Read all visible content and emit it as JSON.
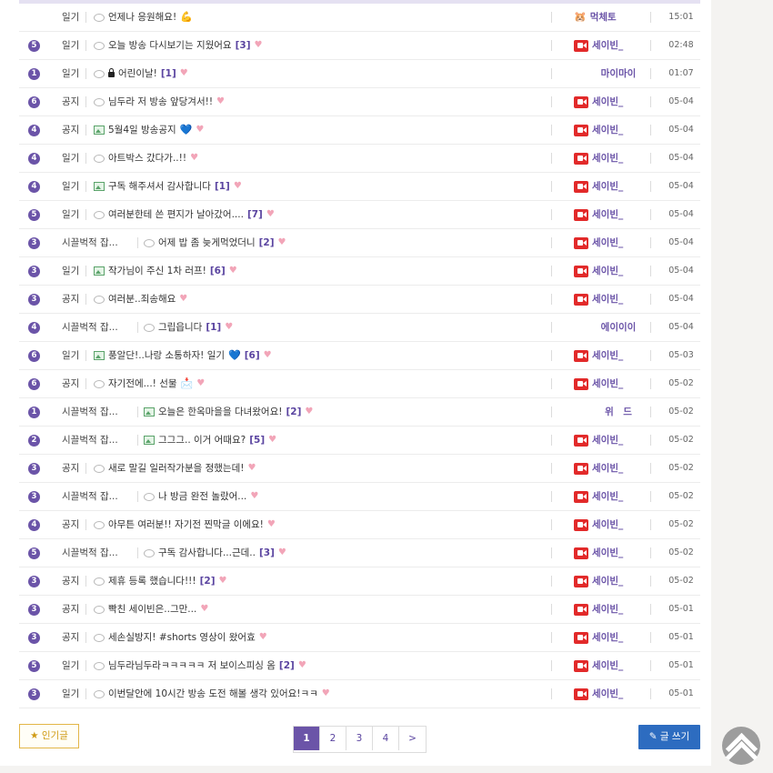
{
  "rows": [
    {
      "rank": "",
      "category": "일기",
      "title": "언제나 응원해요!",
      "emoji": "💪",
      "icon": "chat-icon",
      "count": "",
      "heart": false,
      "author": "먹체토",
      "author_icon": "bear-icon",
      "date": "15:01"
    },
    {
      "rank": "5",
      "category": "일기",
      "title": "오늘 방송 다시보기는 지웠어요",
      "icon": "chat-icon",
      "count": "[3]",
      "heart": true,
      "author": "세이빈_",
      "author_icon": "youtube-icon",
      "date": "02:48"
    },
    {
      "rank": "1",
      "category": "일기",
      "title": "어린이날!",
      "icon": "chat-icon",
      "lock": true,
      "count": "[1]",
      "heart": true,
      "author": "마이마이",
      "author_icon": "",
      "date": "01:07"
    },
    {
      "rank": "6",
      "category": "공지",
      "title": "님두라 저 방송 앞당겨서!!",
      "icon": "chat-icon",
      "count": "",
      "heart": true,
      "author": "세이빈_",
      "author_icon": "youtube-icon",
      "date": "05-04"
    },
    {
      "rank": "4",
      "category": "공지",
      "title": "5월4일 방송공지",
      "emoji": "💙",
      "icon": "image-icon",
      "count": "",
      "heart": true,
      "author": "세이빈_",
      "author_icon": "youtube-icon",
      "date": "05-04"
    },
    {
      "rank": "4",
      "category": "일기",
      "title": "아트박스 갔다가..!!",
      "icon": "chat-icon",
      "count": "",
      "heart": true,
      "author": "세이빈_",
      "author_icon": "youtube-icon",
      "date": "05-04"
    },
    {
      "rank": "4",
      "category": "일기",
      "title": "구독 해주셔서 감사합니다",
      "icon": "image-icon",
      "count": "[1]",
      "heart": true,
      "author": "세이빈_",
      "author_icon": "youtube-icon",
      "date": "05-04"
    },
    {
      "rank": "5",
      "category": "일기",
      "title": "여러분한테 쓴 편지가 날아갔어....",
      "icon": "chat-icon",
      "count": "[7]",
      "heart": true,
      "author": "세이빈_",
      "author_icon": "youtube-icon",
      "date": "05-04"
    },
    {
      "rank": "3",
      "category": "시끌벅적 잡...",
      "title": "어제 밥 좀 늦게먹었더니",
      "icon": "chat-icon",
      "count": "[2]",
      "heart": true,
      "author": "세이빈_",
      "author_icon": "youtube-icon",
      "date": "05-04"
    },
    {
      "rank": "3",
      "category": "일기",
      "title": "작가님이 주신 1차 러프!",
      "icon": "image-icon",
      "count": "[6]",
      "heart": true,
      "author": "세이빈_",
      "author_icon": "youtube-icon",
      "date": "05-04"
    },
    {
      "rank": "3",
      "category": "공지",
      "title": "여러분..죄송해요",
      "icon": "chat-icon",
      "count": "",
      "heart": true,
      "author": "세이빈_",
      "author_icon": "youtube-icon",
      "date": "05-04"
    },
    {
      "rank": "4",
      "category": "시끌벅적 잡...",
      "title": "그립읍니다",
      "icon": "chat-icon",
      "count": "[1]",
      "heart": true,
      "author": "에이이이",
      "author_icon": "",
      "date": "05-04"
    },
    {
      "rank": "6",
      "category": "일기",
      "title": "풍알단!..나랑 소통하자! 일기",
      "emoji": "💙",
      "icon": "image-icon",
      "count": "[6]",
      "heart": true,
      "author": "세이빈_",
      "author_icon": "youtube-icon",
      "date": "05-03"
    },
    {
      "rank": "6",
      "category": "공지",
      "title": "자기전에...! 선물",
      "emoji": "📩",
      "icon": "chat-icon",
      "count": "",
      "heart": true,
      "author": "세이빈_",
      "author_icon": "youtube-icon",
      "date": "05-02"
    },
    {
      "rank": "1",
      "category": "시끌벅적 잡...",
      "title": "오늘은 한옥마을을 다녀왔어요!",
      "icon": "image-icon",
      "count": "[2]",
      "heart": true,
      "author": "위　드",
      "author_icon": "",
      "date": "05-02"
    },
    {
      "rank": "2",
      "category": "시끌벅적 잡...",
      "title": "그그그.. 이거 어때요?",
      "icon": "image-icon",
      "count": "[5]",
      "heart": true,
      "author": "세이빈_",
      "author_icon": "youtube-icon",
      "date": "05-02"
    },
    {
      "rank": "3",
      "category": "공지",
      "title": "새로 말길 일러작가분을 정했는데!",
      "icon": "chat-icon",
      "count": "",
      "heart": true,
      "author": "세이빈_",
      "author_icon": "youtube-icon",
      "date": "05-02"
    },
    {
      "rank": "3",
      "category": "시끌벅적 잡...",
      "title": "나 방금 완전 놀랐어...",
      "icon": "chat-icon",
      "count": "",
      "heart": true,
      "author": "세이빈_",
      "author_icon": "youtube-icon",
      "date": "05-02"
    },
    {
      "rank": "4",
      "category": "공지",
      "title": "아무튼 여러분!! 자기전 찐막글 이에요!",
      "icon": "chat-icon",
      "count": "",
      "heart": true,
      "author": "세이빈_",
      "author_icon": "youtube-icon",
      "date": "05-02"
    },
    {
      "rank": "5",
      "category": "시끌벅적 잡...",
      "title": "구독 감사합니다...근데..",
      "icon": "chat-icon",
      "count": "[3]",
      "heart": true,
      "author": "세이빈_",
      "author_icon": "youtube-icon",
      "date": "05-02"
    },
    {
      "rank": "3",
      "category": "공지",
      "title": "제휴 등록 했습니다!!!",
      "icon": "chat-icon",
      "count": "[2]",
      "heart": true,
      "author": "세이빈_",
      "author_icon": "youtube-icon",
      "date": "05-02"
    },
    {
      "rank": "3",
      "category": "공지",
      "title": "빡친 세이빈은..그만...",
      "icon": "chat-icon",
      "count": "",
      "heart": true,
      "author": "세이빈_",
      "author_icon": "youtube-icon",
      "date": "05-01"
    },
    {
      "rank": "3",
      "category": "공지",
      "title": "세손실방지! #shorts 영상이 왔어효",
      "icon": "chat-icon",
      "count": "",
      "heart": true,
      "author": "세이빈_",
      "author_icon": "youtube-icon",
      "date": "05-01"
    },
    {
      "rank": "5",
      "category": "일기",
      "title": "님두라님두라ㅋㅋㅋㅋㅋ 저 보이스피싱 옴",
      "icon": "chat-icon",
      "count": "[2]",
      "heart": true,
      "author": "세이빈_",
      "author_icon": "youtube-icon",
      "date": "05-01"
    },
    {
      "rank": "3",
      "category": "일기",
      "title": "이번달안에 10시간 방송 도전 해볼 생각 있어요!ㅋㅋ",
      "icon": "chat-icon",
      "count": "",
      "heart": true,
      "author": "세이빈_",
      "author_icon": "youtube-icon",
      "date": "05-01"
    }
  ],
  "footer": {
    "popular_label": "★ 인기글",
    "write_label": "✎ 글 쓰기",
    "pages": [
      "1",
      "2",
      "3",
      "4",
      ">"
    ],
    "active_page": "1"
  },
  "colors": {
    "accent": "#6b54a8",
    "write_button": "#2d6cc0",
    "popular_border": "#e2b646",
    "youtube_red": "#e22a2a",
    "heart": "#f2a5b8"
  }
}
